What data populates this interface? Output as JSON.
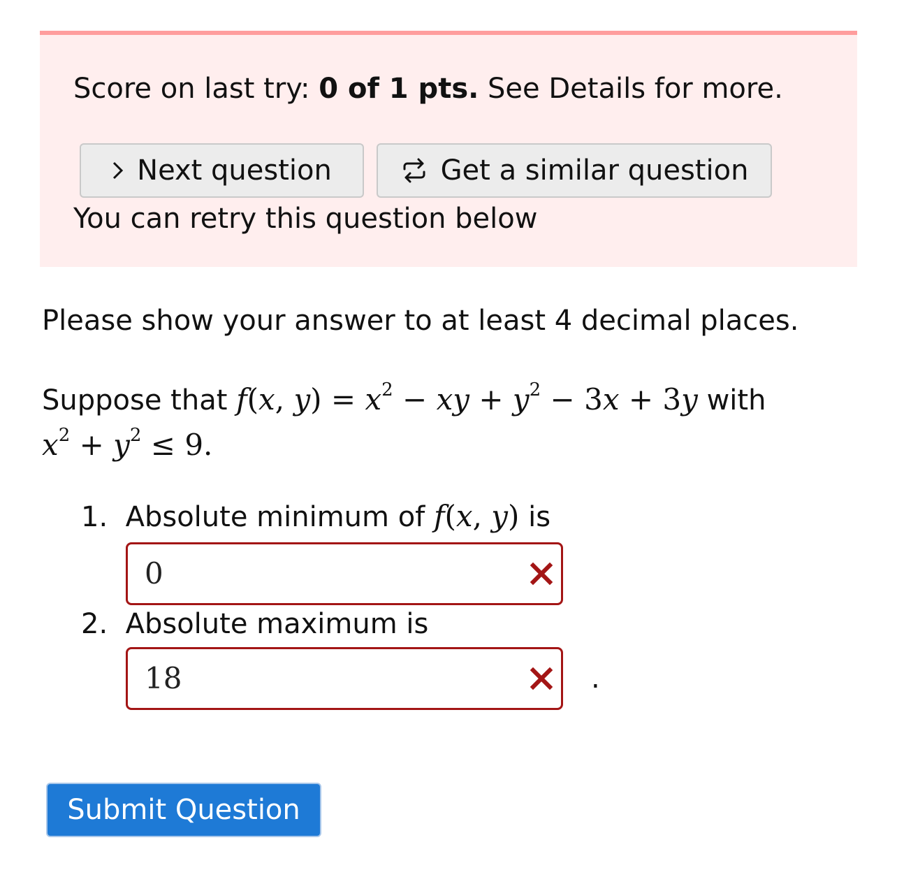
{
  "score": {
    "prefix": "Score on last try: ",
    "points": "0 of 1 pts.",
    "suffix": " See Details for more.",
    "next_label": "Next question",
    "similar_label": "Get a similar question",
    "retry_note": "You can retry this question below"
  },
  "question": {
    "instructions": "Please show your answer to at least 4 decimal places.",
    "intro": "Suppose that ",
    "with_word": " with",
    "part1_prefix": "Absolute minimum of ",
    "part1_suffix": " is",
    "part2_label": "Absolute maximum is",
    "part1_number": "1.",
    "part2_number": "2.",
    "trailing_period": "."
  },
  "answers": {
    "min_value": "0",
    "max_value": "18"
  },
  "submit_label": "Submit Question",
  "colors": {
    "error_border": "#a31515",
    "score_bg": "#ffeeee",
    "score_border": "#ff9d9d",
    "primary_button": "#1e7ad6"
  },
  "icons": {
    "next": "chevron-right-icon",
    "similar": "repeat-icon",
    "incorrect": "x-mark-icon"
  }
}
